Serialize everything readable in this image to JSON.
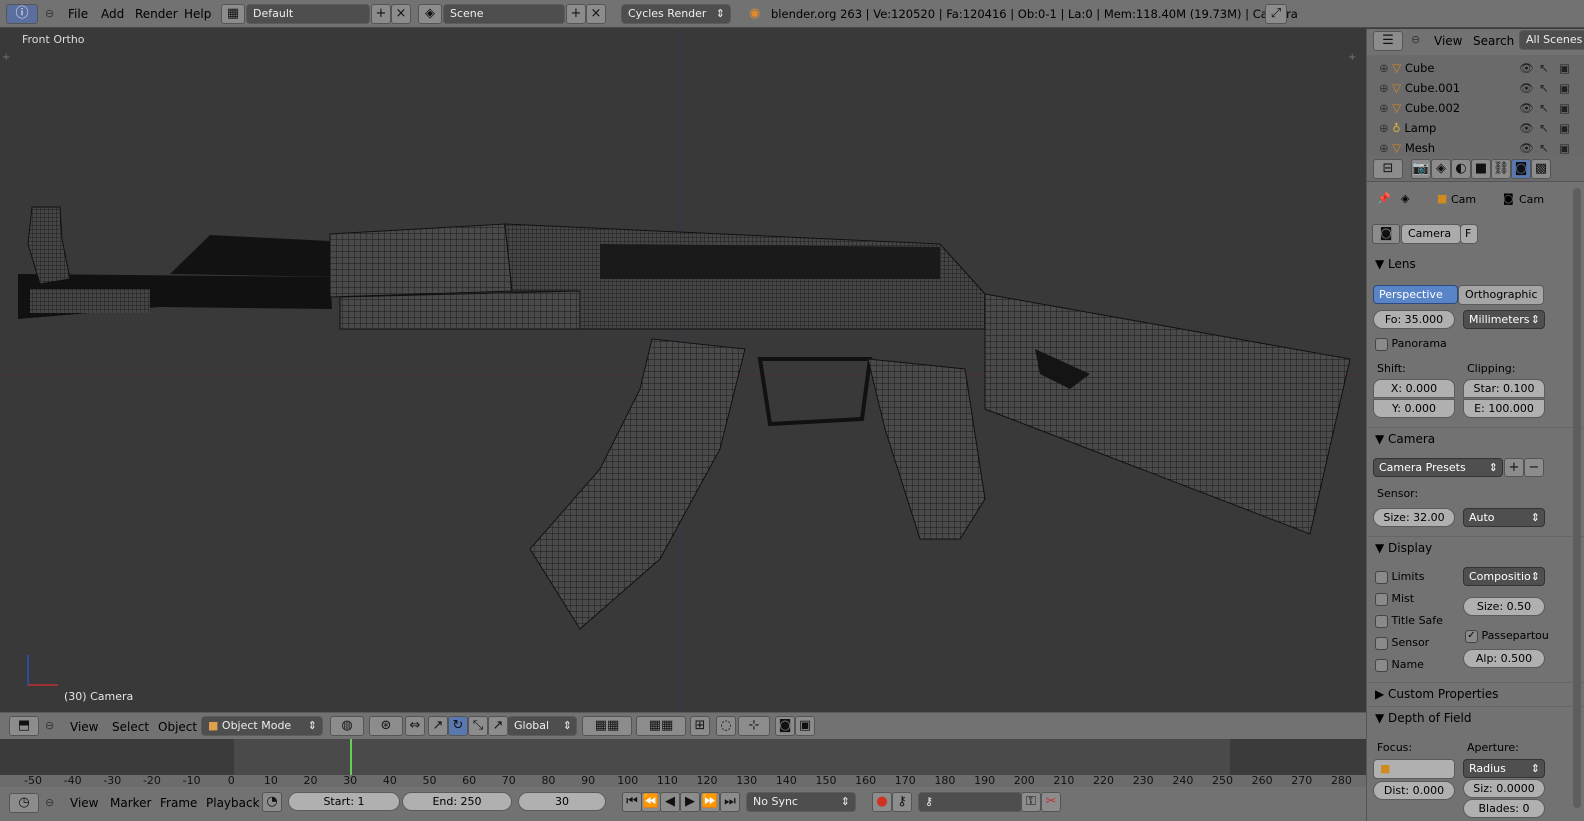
{
  "top_bar": {
    "menu": [
      "File",
      "Add",
      "Render",
      "Help"
    ],
    "screen_layout": "Default",
    "scene": "Scene",
    "render_engine": "Cycles Render",
    "status": "blender.org 263 | Ve:120520 | Fa:120416 | Ob:0-1 | La:0 | Mem:118.40M (19.73M) | Camera"
  },
  "viewport": {
    "view_label": "Front Ortho",
    "object_label": "(30) Camera"
  },
  "viewport_header": {
    "menu": [
      "View",
      "Select",
      "Object"
    ],
    "mode": "Object Mode",
    "orientation": "Global"
  },
  "timeline": {
    "ruler_ticks": [
      "-50",
      "-40",
      "-30",
      "-20",
      "-10",
      "0",
      "10",
      "20",
      "30",
      "40",
      "50",
      "60",
      "70",
      "80",
      "90",
      "100",
      "110",
      "120",
      "130",
      "140",
      "150",
      "160",
      "170",
      "180",
      "190",
      "200",
      "210",
      "220",
      "230",
      "240",
      "250",
      "260",
      "270",
      "280"
    ],
    "menu": [
      "View",
      "Marker",
      "Frame",
      "Playback"
    ],
    "start": "Start: 1",
    "end": "End: 250",
    "current_frame": "30",
    "sync": "No Sync"
  },
  "outliner": {
    "menu": [
      "View",
      "Search"
    ],
    "filter": "All Scenes",
    "items": [
      {
        "name": "Cube"
      },
      {
        "name": "Cube.001"
      },
      {
        "name": "Cube.002"
      },
      {
        "name": "Lamp"
      },
      {
        "name": "Mesh"
      }
    ]
  },
  "properties": {
    "breadcrumb": [
      "Cam",
      "Cam"
    ],
    "datablock_name": "Camera",
    "datablock_flag": "F",
    "lens": {
      "title": "Lens",
      "perspective": "Perspective",
      "orthographic": "Orthographic",
      "focal": "Fo: 35.000",
      "unit": "Millimeters",
      "panorama": "Panorama",
      "shift_label": "Shift:",
      "clipping_label": "Clipping:",
      "shift_x": "X: 0.000",
      "shift_y": "Y: 0.000",
      "clip_start": "Star: 0.100",
      "clip_end": "E: 100.000"
    },
    "camera": {
      "title": "Camera",
      "presets": "Camera Presets",
      "sensor_label": "Sensor:",
      "sensor_size": "Size: 32.00",
      "sensor_fit": "Auto"
    },
    "display": {
      "title": "Display",
      "limits": "Limits",
      "mist": "Mist",
      "title_safe": "Title Safe",
      "sensor": "Sensor",
      "name": "Name",
      "composition": "Compositio",
      "size": "Size: 0.50",
      "passepartout": "Passepartou",
      "alpha": "Alp: 0.500"
    },
    "custom_properties": "Custom Properties",
    "dof": {
      "title": "Depth of Field",
      "focus_label": "Focus:",
      "aperture_label": "Aperture:",
      "aperture_type": "Radius",
      "distance": "Dist: 0.000",
      "size": "Siz: 0.0000",
      "blades": "Blades: 0"
    }
  }
}
